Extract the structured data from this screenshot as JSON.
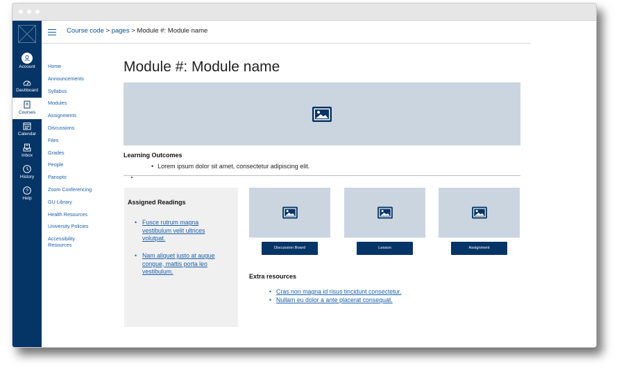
{
  "global_nav": {
    "items": [
      {
        "label": "Account",
        "icon": "account-icon"
      },
      {
        "label": "Dashboard",
        "icon": "dashboard-icon"
      },
      {
        "label": "Courses",
        "icon": "courses-icon"
      },
      {
        "label": "Calendar",
        "icon": "calendar-icon"
      },
      {
        "label": "Inbox",
        "icon": "inbox-icon"
      },
      {
        "label": "History",
        "icon": "history-icon"
      },
      {
        "label": "Help",
        "icon": "help-icon"
      }
    ],
    "collapse_icon": "collapse-icon",
    "collapse_glyph": "|←",
    "brand_color": "#053466"
  },
  "breadcrumb": {
    "course": "Course code",
    "sep1": " > ",
    "pages": "pages",
    "sep2": " > ",
    "current": "Module #: Module name"
  },
  "course_nav": {
    "items": [
      "Home",
      "Announcements",
      "Syllabus",
      "Modules",
      "Assignments",
      "Discussions",
      "Files",
      "Grades",
      "People",
      "Panopto",
      "Zoom Conferencing",
      "GU Library",
      "Health Resources",
      "University Policies",
      "Accessibility Resources"
    ]
  },
  "page": {
    "title": "Module #: Module name",
    "hero_icon": "image-icon",
    "learning_outcomes_title": "Learning Outcomes",
    "learning_outcomes": [
      "Lorem ipsum dolor sit amet, consectetur adipiscing elit."
    ]
  },
  "assigned_readings": {
    "title": "Assigned Readings",
    "items": [
      "Fusce rutrum magna vestibulum velit ultrices volutpat.",
      "Nam aliquet justo at augue congue, mattis porta leo vestibulum."
    ]
  },
  "cards": [
    {
      "button": "Discussion Board",
      "icon": "image-icon"
    },
    {
      "button": "Lesson",
      "icon": "image-icon"
    },
    {
      "button": "Assignment",
      "icon": "image-icon"
    }
  ],
  "extra_resources": {
    "title": "Extra resources",
    "items": [
      "Cras non magna id risus tincidunt consectetur.",
      "Nullam eu dolor a ante placerat consequat."
    ]
  },
  "colors": {
    "accent": "#053466",
    "link": "#1a5fa8",
    "placeholder": "#cbd5e0",
    "panel": "#f0f0f0"
  }
}
